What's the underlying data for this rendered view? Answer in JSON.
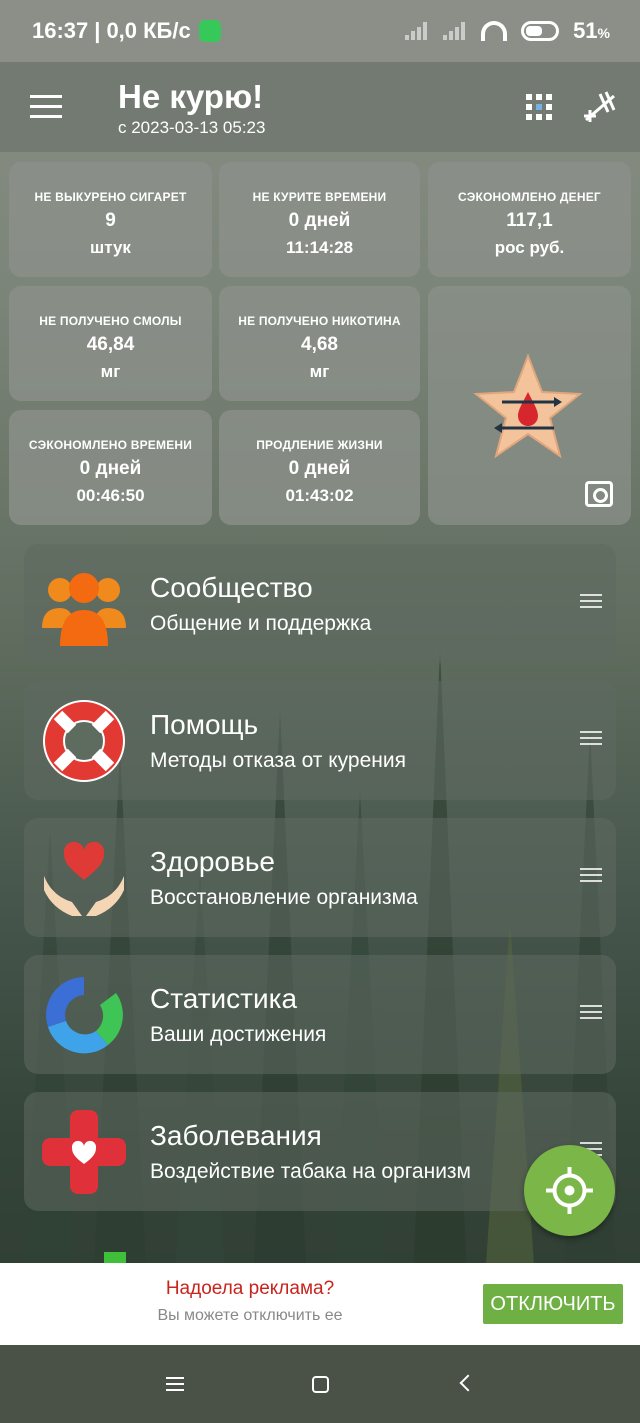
{
  "status_bar": {
    "time": "16:37",
    "speed": "0,0 КБ/с",
    "battery": "51"
  },
  "app_bar": {
    "title": "Не курю!",
    "subtitle": "с 2023-03-13 05:23"
  },
  "stats": [
    {
      "label": "НЕ ВЫКУРЕНО СИГАРЕТ",
      "value": "9",
      "unit": "штук"
    },
    {
      "label": "НЕ КУРИТЕ ВРЕМЕНИ",
      "value": "0 дней",
      "unit": "11:14:28"
    },
    {
      "label": "СЭКОНОМЛЕНО ДЕНЕГ",
      "value": "117,1",
      "unit": "рос руб."
    },
    {
      "label": "НЕ ПОЛУЧЕНО СМОЛЫ",
      "value": "46,84",
      "unit": "мг"
    },
    {
      "label": "НЕ ПОЛУЧЕНО НИКОТИНА",
      "value": "4,68",
      "unit": "мг"
    },
    {
      "label": "СЭКОНОМЛЕНО ВРЕМЕНИ",
      "value": "0 дней",
      "unit": "00:46:50"
    },
    {
      "label": "ПРОДЛЕНИЕ ЖИЗНИ",
      "value": "0 дней",
      "unit": "01:43:02"
    }
  ],
  "menu": [
    {
      "title": "Сообщество",
      "subtitle": "Общение и поддержка",
      "icon": "community-icon"
    },
    {
      "title": "Помощь",
      "subtitle": "Методы отказа от курения",
      "icon": "lifebuoy-icon"
    },
    {
      "title": "Здоровье",
      "subtitle": "Восстановление организма",
      "icon": "heart-hands-icon"
    },
    {
      "title": "Статистика",
      "subtitle": "Ваши достижения",
      "icon": "stats-ring-icon"
    },
    {
      "title": "Заболевания",
      "subtitle": "Воздействие табака на организм",
      "icon": "medical-cross-icon"
    }
  ],
  "ad": {
    "title": "Надоела реклама?",
    "subtitle": "Вы можете отключить ее",
    "button": "ОТКЛЮЧИТЬ"
  },
  "colors": {
    "accent_green": "#7ab648",
    "ad_red": "#c8231c",
    "tile_bg": "#8c918a"
  }
}
